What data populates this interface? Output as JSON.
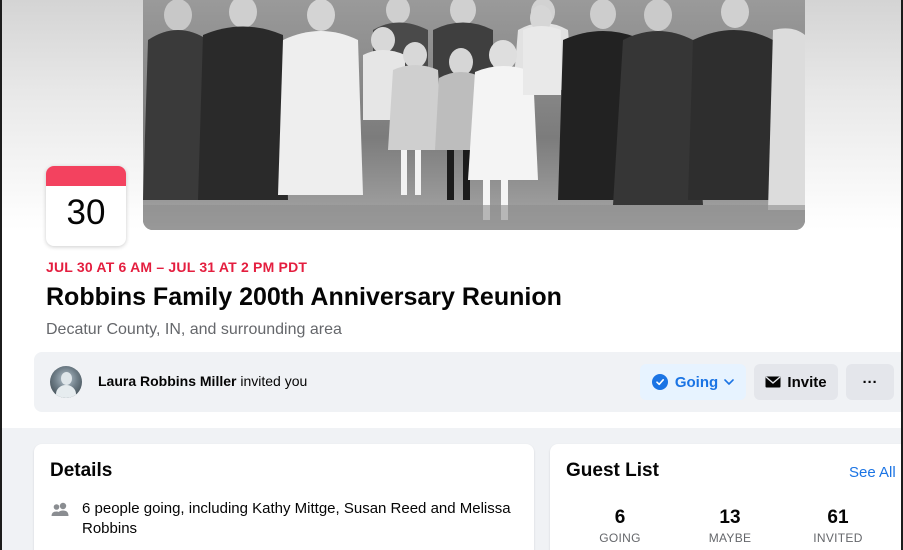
{
  "event": {
    "date_day": "30",
    "when": "JUL 30 AT 6 AM – JUL 31 AT 2 PM PDT",
    "title": "Robbins Family 200th Anniversary Reunion",
    "location": "Decatur County, IN, and surrounding area"
  },
  "invite_bar": {
    "inviter_name": "Laura Robbins Miller",
    "invited_text": "invited you",
    "going_label": "Going",
    "invite_label": "Invite",
    "more_label": "···"
  },
  "details": {
    "title": "Details",
    "people_text": "6 people going, including Kathy Mittge, Susan Reed and Melissa Robbins"
  },
  "guest_list": {
    "title": "Guest List",
    "see_all": "See All",
    "stats": [
      {
        "count": "6",
        "label": "GOING"
      },
      {
        "count": "13",
        "label": "MAYBE"
      },
      {
        "count": "61",
        "label": "INVITED"
      }
    ]
  },
  "colors": {
    "accent": "#1b74e4",
    "date_red": "#e41e3f",
    "tile_red": "#f3425f",
    "page_gray": "#f0f2f5"
  },
  "icons": [
    "calendar-tile",
    "check-circle-icon",
    "chevron-down-icon",
    "envelope-icon",
    "more-dots-icon",
    "people-icon"
  ]
}
